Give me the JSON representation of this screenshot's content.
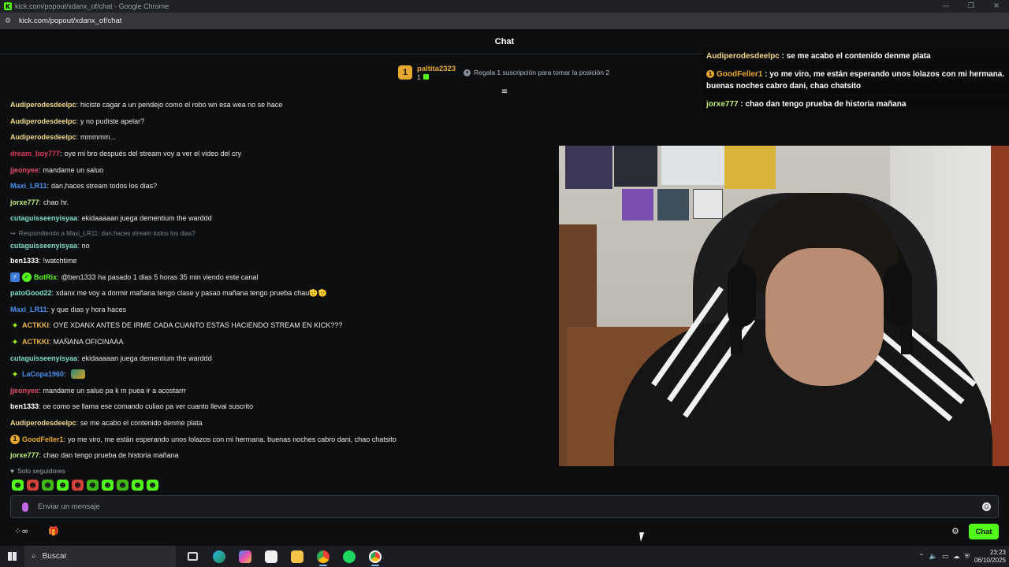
{
  "window": {
    "title": "kick.com/popout/xdanx_of/chat - Google Chrome",
    "url": "kick.com/popout/xdanx_of/chat",
    "favicon": "K",
    "controls": {
      "minimize": "—",
      "restore": "❐",
      "close": "✕"
    }
  },
  "chat": {
    "header_title": "Chat",
    "pinned": {
      "rank": "1",
      "username": "paltita2323",
      "count": "1",
      "gift_text": "Regala 1 suscripción para tomar la posición 2"
    },
    "messages": [
      {
        "user": "Audiperodesdeelpc",
        "color": "#f0d98a",
        "text": "hiciste cagar a un pendejo como el robo wn esa wea no se hace"
      },
      {
        "user": "Audiperodesdeelpc",
        "color": "#f0d98a",
        "text": "y no pudiste apelar?"
      },
      {
        "user": "Audiperodesdeelpc",
        "color": "#f0d98a",
        "text": "mmmmm..."
      },
      {
        "user": "dream_boy777",
        "color": "#e03a5a",
        "text": "oye mi bro después del stream voy a ver el video del cry"
      },
      {
        "user": "jjeonyee",
        "color": "#e44d6e",
        "text": "mandame un saluo"
      },
      {
        "user": "Maxi_LR11",
        "color": "#4b8ff0",
        "text": "dan,haces stream todos los dias?"
      },
      {
        "user": "jorxe777",
        "color": "#bdf07a",
        "text": "chao hr."
      },
      {
        "user": "cutaguisseenyisyaa",
        "color": "#7fe0c8",
        "text": "ekidaaaaan juega dementium the warddd"
      },
      {
        "user": "ben1333",
        "color": "#ffffff",
        "text": "!watchtime"
      },
      {
        "user": "BotRix",
        "color": "#53fc18",
        "text": "@ben1333 ha pasado 1 dias 5 horas 35 min viendo este canal"
      },
      {
        "user": "patoGood22",
        "color": "#7fe0c8",
        "text": "xdanx me voy a dormir mañana tengo clase y pasao mañana tengo prueba chau🫡🫡"
      },
      {
        "user": "Maxi_LR11",
        "color": "#4b8ff0",
        "text": "y que dias y hora haces"
      },
      {
        "user": "ACTKKI",
        "color": "#f0b64a",
        "text": "OYE XDANX ANTES DE IRME CADA CUANTO ESTAS HACIENDO STREAM EN KICK???"
      },
      {
        "user": "ACTKKI",
        "color": "#f0b64a",
        "text": "MAÑANA OFICINAAA"
      },
      {
        "user": "cutaguisseenyisyaa",
        "color": "#7fe0c8",
        "text": "ekidaaaaan juega dementium the warddd"
      },
      {
        "user": "LaCopa1960",
        "color": "#4b8ff0",
        "text": ""
      },
      {
        "user": "jjeonyee",
        "color": "#e44d6e",
        "text": "mandame un saluo pa k m puea ir a acostarrr"
      },
      {
        "user": "ben1333",
        "color": "#ffffff",
        "text": "oe como se llama ese comando culiao pa ver cuanto llevai suscrito"
      },
      {
        "user": "Audiperodesdeelpc",
        "color": "#f0d98a",
        "text": "se me acabo el contenido denme plata"
      },
      {
        "user": "GoodFeller1",
        "color": "#e7a830",
        "text": "yo me viro, me están esperando unos lolazos con mi hermana. buenas noches cabro dani, chao chatsito"
      },
      {
        "user": "jorxe777",
        "color": "#bdf07a",
        "text": "chao dan tengo prueba de historia mañana"
      }
    ],
    "reply": {
      "icon": "↪",
      "text": "Respondiendo a Maxi_LR11: dan,haces stream todos los dias?",
      "user": "cutaguisseenyisyaa",
      "reply_text": "no"
    },
    "followers_only": "Solo seguidores",
    "input_placeholder": "Enviar un mensaje",
    "chat_button": "Chat",
    "bottom_left_icon": "⁘∞",
    "gift_icon": "🎁",
    "gear_icon": "⚙"
  },
  "overlay": [
    {
      "user": "Audiperodesdeelpc",
      "text": "se me acabo el contenido denme plata"
    },
    {
      "user": "GoodFeller1",
      "text": "yo me viro, me están esperando unos lolazos con mi hermana. buenas noches cabro dani, chao chatsito"
    },
    {
      "user": "jorxe777",
      "text": "chao dan tengo prueba de historia mañana"
    }
  ],
  "taskbar": {
    "search_placeholder": "Buscar",
    "time": "23:23",
    "date": "06/10/2025",
    "apps": [
      "task-view",
      "edge",
      "copilot",
      "store",
      "file-explorer",
      "chrome",
      "spotify",
      "chrome-profile"
    ]
  }
}
